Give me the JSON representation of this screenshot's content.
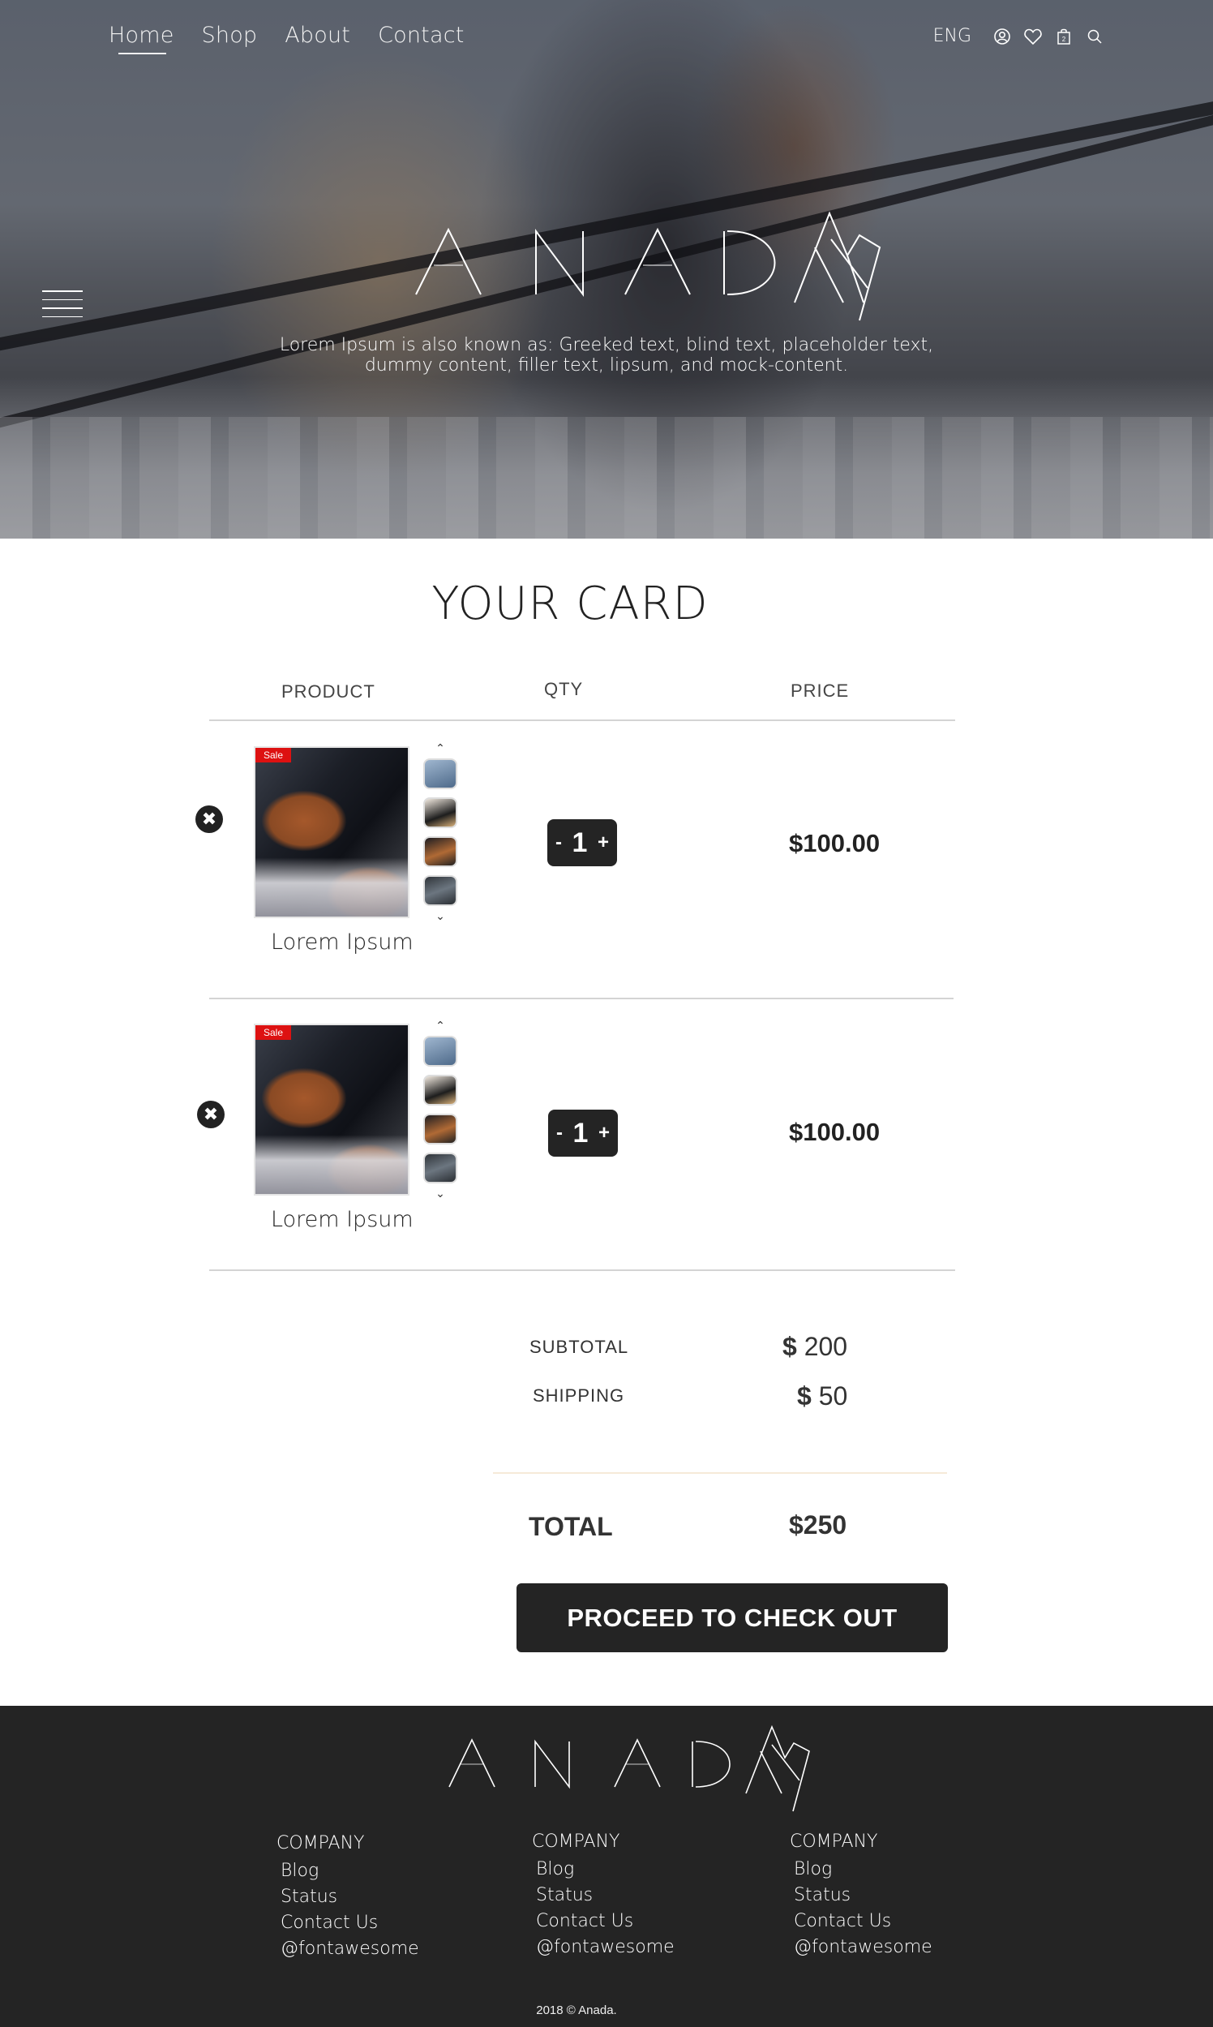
{
  "nav": {
    "items": [
      {
        "label": "Home",
        "active": true
      },
      {
        "label": "Shop"
      },
      {
        "label": "About"
      },
      {
        "label": "Contact"
      }
    ],
    "language": "ENG",
    "icons": [
      "user-icon",
      "heart-icon",
      "bag-icon",
      "search-icon"
    ],
    "cart_count": "2"
  },
  "hero": {
    "logo_text": "ANADA",
    "tagline_line1": "Lorem Ipsum is also known as: Greeked text, blind text, placeholder text,",
    "tagline_line2": "dummy content, filler text, lipsum, and mock-content."
  },
  "cart": {
    "title": "YOUR CARD",
    "headers": {
      "product": "PRODUCT",
      "qty": "QTY",
      "price": "PRICE"
    },
    "items": [
      {
        "badge": "Sale",
        "name": "Lorem Ipsum",
        "qty": "1",
        "minus": "-",
        "plus": "+",
        "price": "$100.00"
      },
      {
        "badge": "Sale",
        "name": "Lorem Ipsum",
        "qty": "1",
        "minus": "-",
        "plus": "+",
        "price": "$100.00"
      }
    ],
    "summary": {
      "subtotal_label": "SUBTOTAL",
      "subtotal_currency": "$",
      "subtotal_value": "200",
      "shipping_label": "SHIPPING",
      "shipping_currency": "$",
      "shipping_value": "50",
      "total_label": "TOTAL",
      "total_value": "$250"
    },
    "checkout_label": "PROCEED TO CHECK OUT"
  },
  "footer": {
    "logo_text": "ANADA",
    "columns": [
      {
        "heading": "COMPANY",
        "items": [
          "Blog",
          "Status",
          "Contact Us",
          "@fontawesome"
        ]
      },
      {
        "heading": "COMPANY",
        "items": [
          "Blog",
          "Status",
          "Contact Us",
          "@fontawesome"
        ]
      },
      {
        "heading": "COMPANY",
        "items": [
          "Blog",
          "Status",
          "Contact Us",
          "@fontawesome"
        ]
      }
    ],
    "copyright": "2018 © Anada."
  },
  "colors": {
    "dark": "#242424",
    "sale": "#dd1111",
    "footer_bg": "#242424"
  }
}
